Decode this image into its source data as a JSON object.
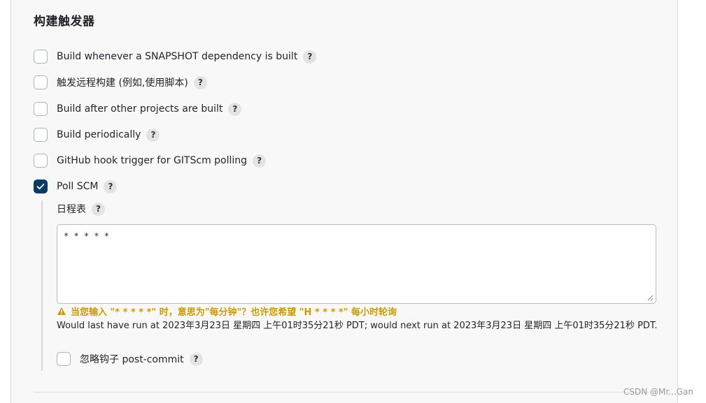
{
  "section": {
    "title": "构建触发器"
  },
  "triggers": [
    {
      "label": "Build whenever a SNAPSHOT dependency is built",
      "checked": false
    },
    {
      "label": "触发远程构建 (例如,使用脚本)",
      "checked": false
    },
    {
      "label": "Build after other projects are built",
      "checked": false
    },
    {
      "label": "Build periodically",
      "checked": false
    },
    {
      "label": "GitHub hook trigger for GITScm polling",
      "checked": false
    },
    {
      "label": "Poll SCM",
      "checked": true
    }
  ],
  "poll_scm": {
    "schedule_label": "日程表",
    "schedule_value": "* * * * *",
    "warning_text": "当您输入 \"* * * * *\" 时，意思为\"每分钟\"？也许您希望 \"H * * * *\" 每小时轮询",
    "run_info": "Would last have run at 2023年3月23日 星期四 上午01时35分21秒 PDT; would next run at 2023年3月23日 星期四 上午01时35分21秒 PDT.",
    "ignore_hooks_label": "忽略钩子 post-commit",
    "ignore_hooks_checked": false
  },
  "help_symbol": "?",
  "icons": {
    "check": "check-icon",
    "warning": "warning-triangle-icon",
    "help": "help-icon"
  },
  "colors": {
    "checked_bg": "#0b3b61",
    "warning": "#c99a00",
    "panel_bg": "#f8f8f8"
  },
  "watermark": "CSDN @Mr...Gan"
}
